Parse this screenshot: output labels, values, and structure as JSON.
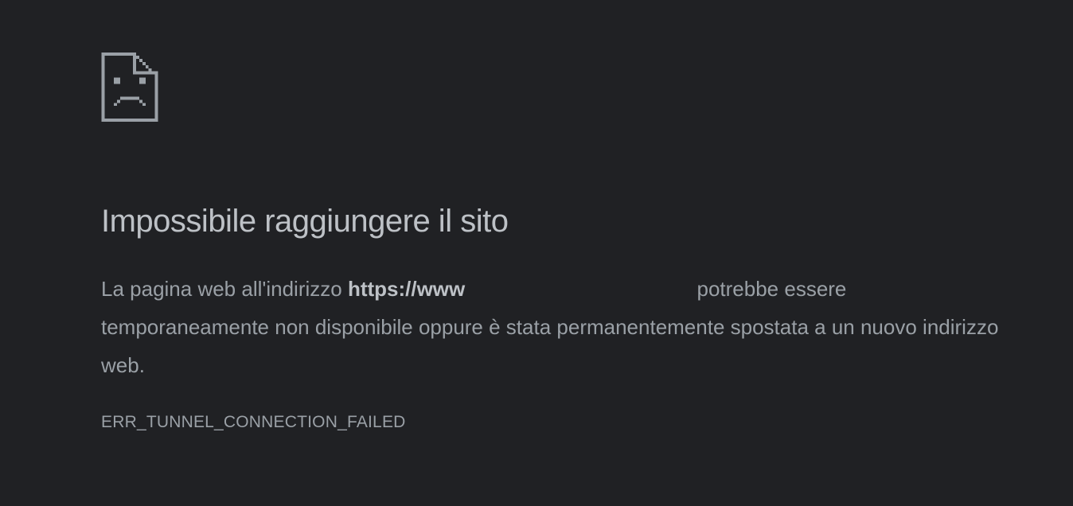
{
  "page": {
    "icon": "sad-document-icon",
    "title": "Impossibile raggiungere il sito",
    "description": {
      "prefix": "La pagina web all'indirizzo ",
      "url": "https://www",
      "suffix": " potrebbe essere temporaneamente non disponibile oppure è stata permanentemente spostata a un nuovo indirizzo web."
    },
    "error_code": "ERR_TUNNEL_CONNECTION_FAILED"
  },
  "colors": {
    "background": "#202124",
    "title": "#bdc1c6",
    "text": "#9aa0a6",
    "icon": "#9aa0a6"
  }
}
